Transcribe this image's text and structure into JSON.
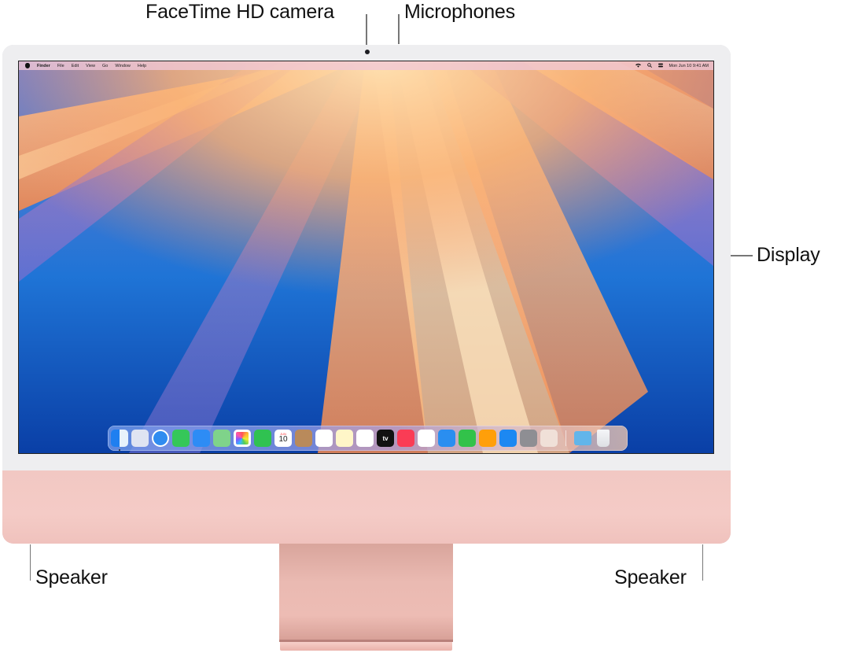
{
  "callouts": {
    "camera": "FaceTime HD camera",
    "microphones": "Microphones",
    "display": "Display",
    "speaker_left": "Speaker",
    "speaker_right": "Speaker"
  },
  "menubar": {
    "left_items": [
      "Finder",
      "File",
      "Edit",
      "View",
      "Go",
      "Window",
      "Help"
    ],
    "status_icons": [
      "wifi-icon",
      "search-icon",
      "control-center-icon"
    ],
    "datetime": "Mon Jun 10  9:41 AM"
  },
  "dock": {
    "apps": [
      {
        "name": "Finder",
        "icon": "finder-icon",
        "color": "#3aa0f0",
        "running": true
      },
      {
        "name": "Launchpad",
        "icon": "launchpad-icon",
        "color": "#dfe4f2"
      },
      {
        "name": "Safari",
        "icon": "safari-icon",
        "color": "#2f8cf0"
      },
      {
        "name": "Messages",
        "icon": "messages-icon",
        "color": "#35c759"
      },
      {
        "name": "Mail",
        "icon": "mail-icon",
        "color": "#2d8cf5"
      },
      {
        "name": "Maps",
        "icon": "maps-icon",
        "color": "#7fd38a"
      },
      {
        "name": "Photos",
        "icon": "photos-icon",
        "color": "#ffffff"
      },
      {
        "name": "FaceTime",
        "icon": "facetime-icon",
        "color": "#30c251"
      },
      {
        "name": "Calendar",
        "icon": "calendar-icon",
        "color": "#ffffff",
        "month": "JUN",
        "day": "10"
      },
      {
        "name": "Contacts",
        "icon": "contacts-icon",
        "color": "#b98a5b"
      },
      {
        "name": "Reminders",
        "icon": "reminders-icon",
        "color": "#ffffff"
      },
      {
        "name": "Notes",
        "icon": "notes-icon",
        "color": "#fff6c8"
      },
      {
        "name": "Freeform",
        "icon": "freeform-icon",
        "color": "#ffffff"
      },
      {
        "name": "TV",
        "icon": "tv-icon",
        "color": "#111111",
        "label": "tv"
      },
      {
        "name": "Music",
        "icon": "music-icon",
        "color": "#fa3c55"
      },
      {
        "name": "News",
        "icon": "news-icon",
        "color": "#ffffff"
      },
      {
        "name": "Keynote",
        "icon": "keynote-icon",
        "color": "#2a8ef0"
      },
      {
        "name": "Numbers",
        "icon": "numbers-icon",
        "color": "#32c24a"
      },
      {
        "name": "Pages",
        "icon": "pages-icon",
        "color": "#ff9f0a"
      },
      {
        "name": "App Store",
        "icon": "app-store-icon",
        "color": "#1c88f2"
      },
      {
        "name": "System Settings",
        "icon": "system-settings-icon",
        "color": "#8e8e93"
      },
      {
        "name": "iPhone Mirroring",
        "icon": "iphone-mirroring-icon",
        "color": "#f0e0d8"
      }
    ],
    "extras": [
      {
        "name": "Downloads",
        "icon": "downloads-folder-icon",
        "color": "#62b5ea"
      },
      {
        "name": "Trash",
        "icon": "trash-icon",
        "color": "#e9ecef"
      }
    ]
  },
  "colors": {
    "bezel": "#eeeef0",
    "chin": "#f3c9c4",
    "stand": "#e8b4ac"
  }
}
